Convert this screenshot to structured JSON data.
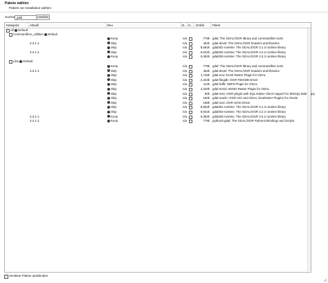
{
  "header": {
    "title": "Pakete wählen",
    "subtitle": "Pakete zur Installation wählen"
  },
  "search": {
    "label": "Suchen",
    "value": "gdal",
    "clear_label": "Löschen"
  },
  "columns": {
    "category": "Kategorie",
    "current": "Aktuell",
    "new": "Neu",
    "bin": "B...",
    "src": "S...",
    "size": "Größe",
    "package": "Paket"
  },
  "tree": {
    "all": "All",
    "all_action": "Default",
    "commandline": "Commandline_Utilities",
    "commandline_action": "Default",
    "libs": "Libs",
    "libs_action": "Default"
  },
  "rows_cmd": [
    {
      "current": "",
      "new": "Keep",
      "bin": "n/a",
      "size": "778k",
      "package": "gdal: The GDAL/OGR library and commandline tools"
    },
    {
      "current": "3.3.1-1",
      "new": "Skip",
      "bin": "n/a",
      "size": "462k",
      "package": "gdal-devel: The GDAL/OGR headers and libraries"
    },
    {
      "current": "",
      "new": "Skip",
      "bin": "n/a",
      "size": "8,562k",
      "package": "gdal301-runtime: The GDAL/OGR 3.1.3 runtime library"
    },
    {
      "current": "3.3.1-1",
      "new": "Skip",
      "bin": "n/a",
      "size": "8,942k",
      "package": "gdal302-runtime: The GDAL/OGR 3.2.2 runtime library"
    },
    {
      "current": "",
      "new": "Keep",
      "bin": "n/a",
      "size": "9,392k",
      "package": "gdal303-runtime: The GDAL/OGR 3.3.2 runtime library"
    }
  ],
  "rows_libs": [
    {
      "current": "",
      "new": "Keep",
      "bin": "n/a",
      "size": "778k",
      "package": "gdal: The GDAL/OGR library and commandline tools"
    },
    {
      "current": "3.3.1-1",
      "new": "Skip",
      "bin": "n/a",
      "size": "462k",
      "package": "gdal-devel: The GDAL/OGR headers and libraries"
    },
    {
      "current": "",
      "new": "Skip",
      "bin": "n/a",
      "size": "1,746k",
      "package": "gdal-ecw: ECW Raster Plugin for GDAL"
    },
    {
      "current": "",
      "new": "Skip",
      "bin": "n/a",
      "size": "2,343k",
      "package": "gdal-filegdb: OGR FileGDB Driver"
    },
    {
      "current": "",
      "new": "Skip",
      "bin": "n/a",
      "size": "113k",
      "package": "gdal-hdf5: HDF5 Plugin for GDAL"
    },
    {
      "current": "",
      "new": "Skip",
      "bin": "n/a",
      "size": "3,333k",
      "package": "gdal-mrsid: MrSID Raster Plugin for GDAL"
    },
    {
      "current": "",
      "new": "Skip",
      "bin": "n/a",
      "size": "80k",
      "package": "gdal-mss: OGR plugin with SQL Native Client support for MSSQL Bulk Copy"
    },
    {
      "current": "",
      "new": "Skip",
      "bin": "n/a",
      "size": "160k",
      "package": "gdal-oracle: OGR OCI and GDAL GeoRaster Plugins for Oracle"
    },
    {
      "current": "",
      "new": "Skip",
      "bin": "n/a",
      "size": "158k",
      "package": "gdal-sosi: OGR SOSI Driver"
    },
    {
      "current": "",
      "new": "Skip",
      "bin": "n/a",
      "size": "8,562k",
      "package": "gdal301-runtime: The GDAL/OGR 3.1.3 runtime library"
    },
    {
      "current": "",
      "new": "Skip",
      "bin": "n/a",
      "size": "8,942k",
      "package": "gdal302-runtime: The GDAL/OGR 3.2.2 runtime library"
    },
    {
      "current": "3.3.1-1",
      "new": "Keep",
      "bin": "n/a",
      "size": "9,392k",
      "package": "gdal303-runtime: The GDAL/OGR 3.3.2 runtime library"
    },
    {
      "current": "3.3.1-1",
      "new": "Keep",
      "bin": "n/a",
      "size": "778k",
      "package": "python3-gdal: The GDAL/OGR Python3 Bindings and Scripts"
    }
  ],
  "footer": {
    "hide_obsolete_label": "Veraltete Pakete ausblenden",
    "hide_obsolete_checked": true
  }
}
